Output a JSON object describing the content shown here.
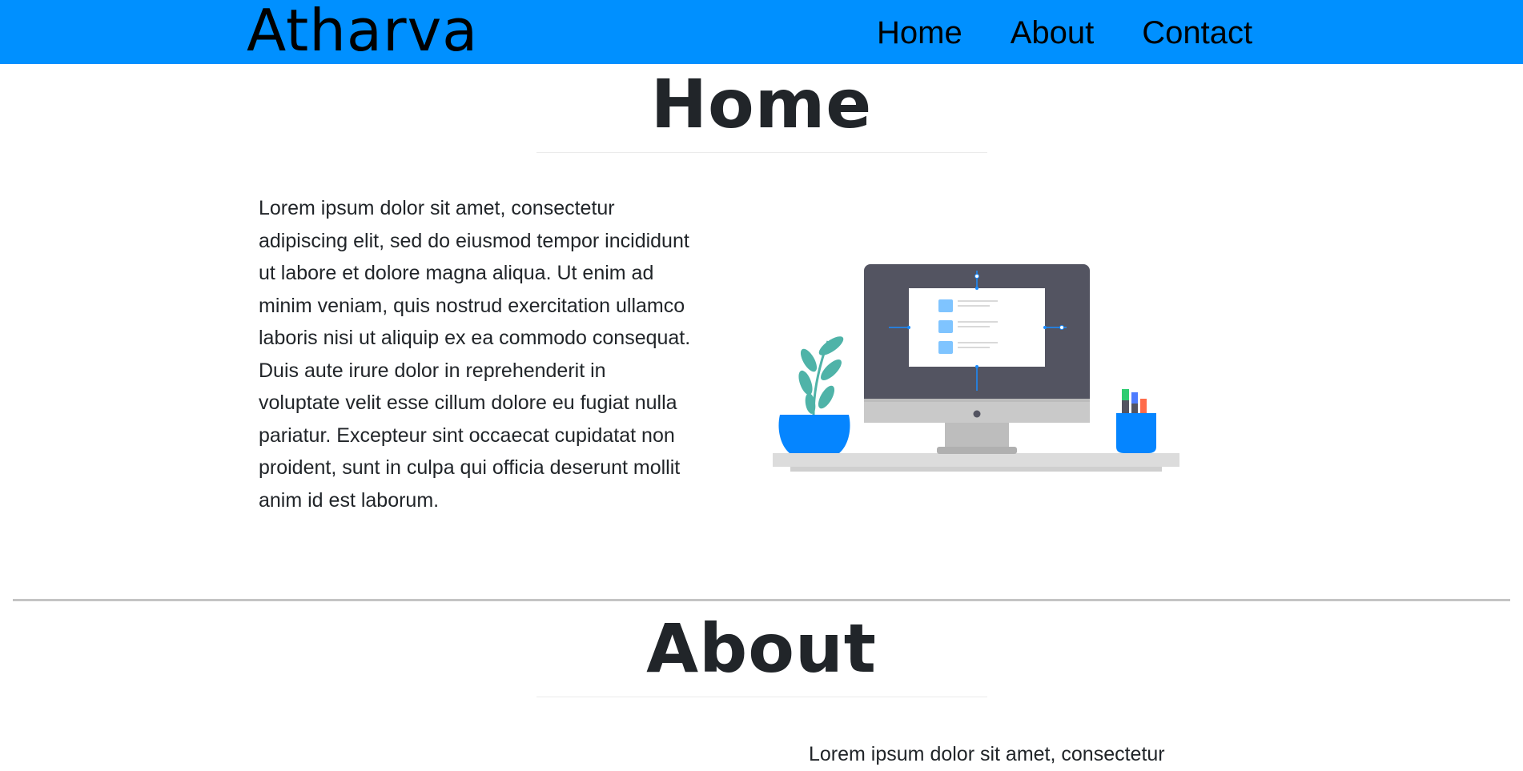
{
  "navbar": {
    "brand": "Atharva",
    "links": [
      {
        "label": "Home"
      },
      {
        "label": "About"
      },
      {
        "label": "Contact"
      }
    ],
    "background_color": "#0090ff"
  },
  "home": {
    "title": "Home",
    "body": "Lorem ipsum dolor sit amet, consectetur adipiscing elit, sed do eiusmod tempor incididunt ut labore et dolore magna aliqua. Ut enim ad minim veniam, quis nostrud exercitation ullamco laboris nisi ut aliquip ex ea commodo consequat. Duis aute irure dolor in reprehenderit in voluptate velit esse cillum dolore eu fugiat nulla pariatur. Excepteur sint occaecat cupidatat non proident, sunt in culpa qui officia deserunt mollit anim id est laborum.",
    "illustration_icon": "desktop-workspace-illustration"
  },
  "about": {
    "title": "About",
    "body": "Lorem ipsum dolor sit amet, consectetur"
  },
  "colors": {
    "accent": "#0090ff",
    "text": "#212529",
    "divider": "#c4c4c4"
  }
}
